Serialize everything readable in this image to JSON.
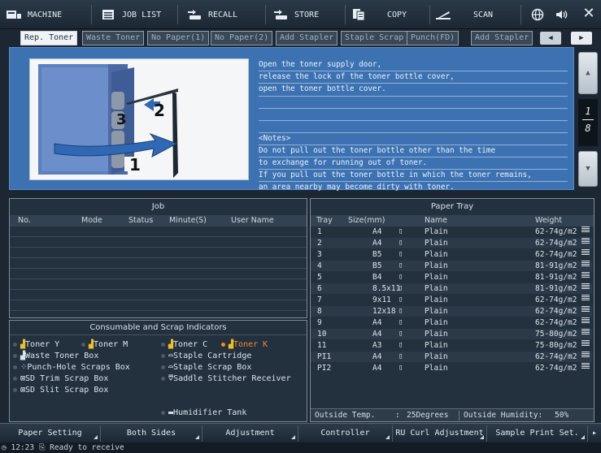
{
  "nav": {
    "items": [
      {
        "label": "MACHINE",
        "icon": "machine-icon"
      },
      {
        "label": "JOB LIST",
        "icon": "job-list-icon"
      },
      {
        "label": "RECALL",
        "icon": "recall-icon"
      },
      {
        "label": "STORE",
        "icon": "store-icon"
      },
      {
        "label": "COPY",
        "icon": "copy-icon"
      },
      {
        "label": "SCAN",
        "icon": "scan-icon"
      }
    ],
    "close_label": "✕"
  },
  "tabs": [
    "Rep. Toner",
    "Waste Toner",
    "No Paper(1)",
    "No Paper(2)",
    "Add Stapler",
    "Staple Scrap",
    "Punch(FD)",
    "Add Stapler"
  ],
  "instruction": {
    "lines": [
      "Open the toner supply door,",
      "release the lock of the toner bottle cover,",
      "open the toner bottle cover."
    ],
    "notes": [
      "<Notes>",
      "Do not pull out the toner bottle other than the time",
      "to exchange for running out of toner.",
      "If you pull out the toner bottle in which the toner remains,",
      "an area nearby may become dirty with toner."
    ],
    "step_labels": [
      "1",
      "2",
      "3"
    ],
    "page_current": "1",
    "page_total": "8"
  },
  "job": {
    "title": "Job",
    "columns": [
      "No.",
      "Mode",
      "Status",
      "Minute(S)",
      "User Name"
    ]
  },
  "consumables": {
    "title": "Consumable and Scrap Indicators",
    "items": [
      {
        "label": "Toner Y",
        "on": false
      },
      {
        "label": "Toner M",
        "on": false
      },
      {
        "label": "Toner C",
        "on": false
      },
      {
        "label": "Toner K",
        "on": true
      },
      {
        "label": "Waste Toner Box",
        "on": false
      },
      {
        "label": "Staple Cartridge",
        "on": false
      },
      {
        "label": "Punch-Hole Scraps Box",
        "on": false
      },
      {
        "label": "Staple Scrap Box",
        "on": false
      },
      {
        "label": "SD Trim Scrap Box",
        "on": false
      },
      {
        "label": "Saddle Stitcher Receiver",
        "on": false
      },
      {
        "label": "SD Slit Scrap Box",
        "on": false
      },
      {
        "label": "Humidifier Tank",
        "on": false
      }
    ],
    "active_color": "#f28a2a"
  },
  "paper_tray": {
    "title": "Paper Tray",
    "columns": [
      "Tray",
      "Size(mm)",
      "Name",
      "Weight"
    ],
    "rows": [
      [
        "1",
        "A4",
        "Plain",
        "62-74g/m2"
      ],
      [
        "2",
        "A4",
        "Plain",
        "62-74g/m2"
      ],
      [
        "3",
        "B5",
        "Plain",
        "62-74g/m2"
      ],
      [
        "4",
        "B5",
        "Plain",
        "81-91g/m2"
      ],
      [
        "5",
        "B4",
        "Plain",
        "81-91g/m2"
      ],
      [
        "6",
        "8.5x11",
        "Plain",
        "81-91g/m2"
      ],
      [
        "7",
        "9x11",
        "Plain",
        "62-74g/m2"
      ],
      [
        "8",
        "12x18",
        "Plain",
        "62-74g/m2"
      ],
      [
        "9",
        "A4",
        "Plain",
        "62-74g/m2"
      ],
      [
        "10",
        "A4",
        "Plain",
        "75-80g/m2"
      ],
      [
        "11",
        "A3",
        "Plain",
        "75-80g/m2"
      ],
      [
        "PI1",
        "A4",
        "Plain",
        "62-74g/m2"
      ],
      [
        "PI2",
        "A4",
        "Plain",
        "62-74g/m2"
      ]
    ],
    "outside_temp_label": "Outside Temp.",
    "outside_temp_sep": ":",
    "outside_temp_value": "25Degrees",
    "outside_humidity_label": "Outside Humidity:",
    "outside_humidity_value": "50%"
  },
  "bottom": {
    "buttons": [
      "Paper Setting",
      "Both Sides",
      "Adjustment",
      "Controller",
      "RU Curl Adjustment",
      "Sample Print Set."
    ]
  },
  "status": {
    "time": "12:23",
    "text": "Ready to receive"
  }
}
